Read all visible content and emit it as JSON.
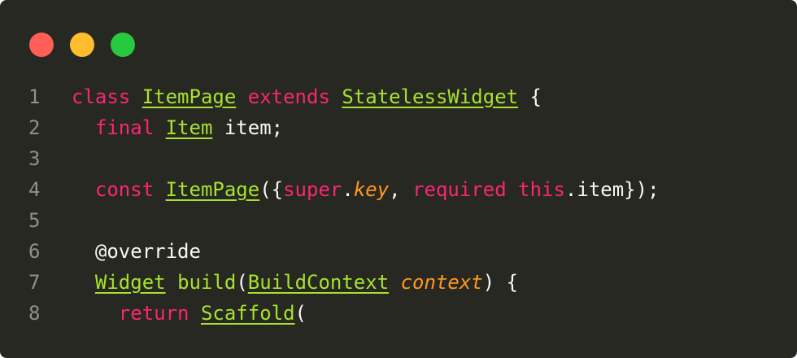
{
  "colors": {
    "background": "#272822",
    "line_number": "#8f908a",
    "plain": "#f8f8f2",
    "keyword": "#f92672",
    "type": "#a6e22e",
    "param": "#fd971f",
    "close_dot": "#ff5f56",
    "minimize_dot": "#ffbd2e",
    "maximize_dot": "#27c93f"
  },
  "lines": [
    {
      "num": "1",
      "tokens": [
        {
          "t": "class",
          "k": "kw"
        },
        {
          "t": " ",
          "k": "pl"
        },
        {
          "t": "ItemPage",
          "k": "ty"
        },
        {
          "t": " ",
          "k": "pl"
        },
        {
          "t": "extends",
          "k": "kw"
        },
        {
          "t": " ",
          "k": "pl"
        },
        {
          "t": "StatelessWidget",
          "k": "ty"
        },
        {
          "t": " {",
          "k": "pl"
        }
      ]
    },
    {
      "num": "2",
      "tokens": [
        {
          "t": "  ",
          "k": "pl"
        },
        {
          "t": "final",
          "k": "kw"
        },
        {
          "t": " ",
          "k": "pl"
        },
        {
          "t": "Item",
          "k": "ty"
        },
        {
          "t": " item;",
          "k": "pl"
        }
      ]
    },
    {
      "num": "3",
      "tokens": []
    },
    {
      "num": "4",
      "tokens": [
        {
          "t": "  ",
          "k": "pl"
        },
        {
          "t": "const",
          "k": "kw"
        },
        {
          "t": " ",
          "k": "pl"
        },
        {
          "t": "ItemPage",
          "k": "ty"
        },
        {
          "t": "({",
          "k": "pl"
        },
        {
          "t": "super",
          "k": "kw"
        },
        {
          "t": ".",
          "k": "pl"
        },
        {
          "t": "key",
          "k": "it"
        },
        {
          "t": ", ",
          "k": "pl"
        },
        {
          "t": "required",
          "k": "kw"
        },
        {
          "t": " ",
          "k": "pl"
        },
        {
          "t": "this",
          "k": "kw"
        },
        {
          "t": ".item});",
          "k": "pl"
        }
      ]
    },
    {
      "num": "5",
      "tokens": []
    },
    {
      "num": "6",
      "tokens": [
        {
          "t": "  @override",
          "k": "pl"
        }
      ]
    },
    {
      "num": "7",
      "tokens": [
        {
          "t": "  ",
          "k": "pl"
        },
        {
          "t": "Widget",
          "k": "ty"
        },
        {
          "t": " ",
          "k": "pl"
        },
        {
          "t": "build",
          "k": "fn"
        },
        {
          "t": "(",
          "k": "pl"
        },
        {
          "t": "BuildContext",
          "k": "ty"
        },
        {
          "t": " ",
          "k": "pl"
        },
        {
          "t": "context",
          "k": "it"
        },
        {
          "t": ") {",
          "k": "pl"
        }
      ]
    },
    {
      "num": "8",
      "tokens": [
        {
          "t": "    ",
          "k": "pl"
        },
        {
          "t": "return",
          "k": "kw"
        },
        {
          "t": " ",
          "k": "pl"
        },
        {
          "t": "Scaffold",
          "k": "ty"
        },
        {
          "t": "(",
          "k": "pl"
        }
      ]
    }
  ]
}
